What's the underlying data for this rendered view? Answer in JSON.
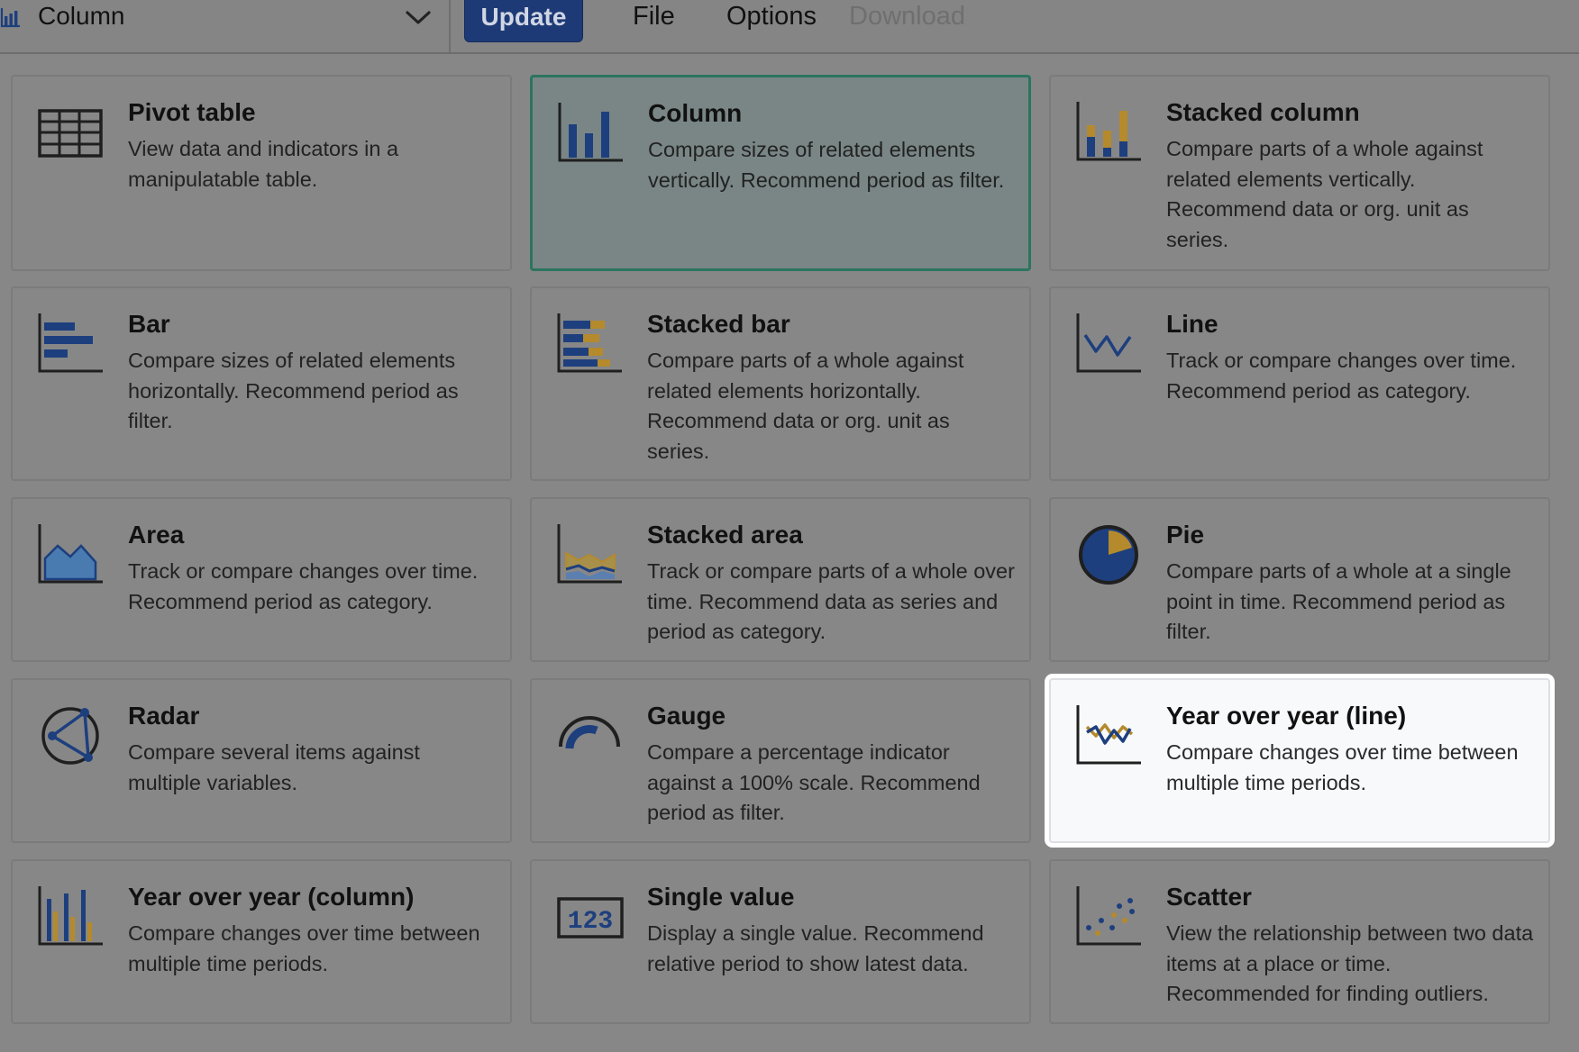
{
  "toolbar": {
    "selected_type": "Column",
    "selected_type_icon": "column-chart-icon",
    "update_label": "Update",
    "file_label": "File",
    "options_label": "Options",
    "download_label": "Download"
  },
  "colors": {
    "blue": "#1d3f7e",
    "gold": "#b48a2c",
    "dark": "#1f1f1f",
    "selected_border": "#2b7460",
    "update_button": "#1d3a76"
  },
  "vis_types": [
    {
      "title": "Pivot table",
      "desc": "View data and indicators in a manipulatable table.",
      "icon": "pivot-table-icon"
    },
    {
      "title": "Column",
      "desc": "Compare sizes of related elements vertically. Recommend period as filter.",
      "icon": "column-chart-icon",
      "state": "selected"
    },
    {
      "title": "Stacked column",
      "desc": "Compare parts of a whole against related elements vertically. Recommend data or org. unit as series.",
      "icon": "stacked-column-icon"
    },
    {
      "title": "Bar",
      "desc": "Compare sizes of related elements horizontally. Recommend period as filter.",
      "icon": "bar-chart-icon"
    },
    {
      "title": "Stacked bar",
      "desc": "Compare parts of a whole against related elements horizontally. Recommend data or org. unit as series.",
      "icon": "stacked-bar-icon"
    },
    {
      "title": "Line",
      "desc": "Track or compare changes over time. Recommend period as category.",
      "icon": "line-chart-icon"
    },
    {
      "title": "Area",
      "desc": "Track or compare changes over time. Recommend period as category.",
      "icon": "area-chart-icon"
    },
    {
      "title": "Stacked area",
      "desc": "Track or compare parts of a whole over time. Recommend data as series and period as category.",
      "icon": "stacked-area-icon"
    },
    {
      "title": "Pie",
      "desc": "Compare parts of a whole at a single point in time. Recommend period as filter.",
      "icon": "pie-chart-icon"
    },
    {
      "title": "Radar",
      "desc": "Compare several items against multiple variables.",
      "icon": "radar-chart-icon"
    },
    {
      "title": "Gauge",
      "desc": "Compare a percentage indicator against a 100% scale. Recommend period as filter.",
      "icon": "gauge-icon"
    },
    {
      "title": "Year over year (line)",
      "desc": "Compare changes over time between multiple time periods.",
      "icon": "year-over-year-line-icon",
      "state": "highlighted"
    },
    {
      "title": "Year over year (column)",
      "desc": "Compare changes over time between multiple time periods.",
      "icon": "year-over-year-column-icon"
    },
    {
      "title": "Single value",
      "desc": "Display a single value. Recommend relative period to show latest data.",
      "icon": "single-value-icon",
      "icon_text": "123"
    },
    {
      "title": "Scatter",
      "desc": "View the relationship between two data items at a place or time. Recommended for finding outliers.",
      "icon": "scatter-chart-icon"
    }
  ]
}
